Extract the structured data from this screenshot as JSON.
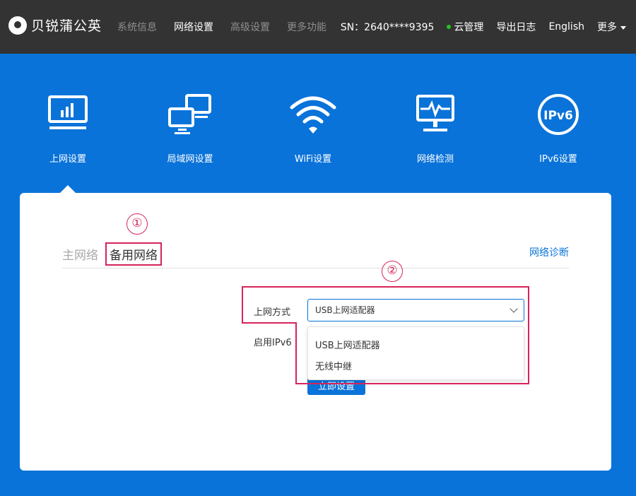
{
  "brand": {
    "name": "贝锐蒲公英"
  },
  "nav": [
    {
      "label": "系统信息",
      "active": false
    },
    {
      "label": "网络设置",
      "active": true
    },
    {
      "label": "高级设置",
      "active": false
    },
    {
      "label": "更多功能",
      "active": false
    }
  ],
  "header_right": {
    "sn": "SN：2640****9395",
    "cloud": "云管理",
    "cloud_status_color": "#22c522",
    "export_log": "导出日志",
    "language": "English",
    "more": "更多"
  },
  "modules": [
    {
      "label": "上网设置",
      "icon": "monitor-chart-icon"
    },
    {
      "label": "局域网设置",
      "icon": "lan-computers-icon"
    },
    {
      "label": "WiFi设置",
      "icon": "wifi-icon"
    },
    {
      "label": "网络检测",
      "icon": "monitor-pulse-icon"
    },
    {
      "label": "IPv6设置",
      "icon": "ipv6-icon",
      "icon_text": "IPv6"
    }
  ],
  "tabs": {
    "main": "主网络",
    "backup": "备用网络",
    "diagnose": "网络诊断"
  },
  "annotations": {
    "marker1": "①",
    "marker2": "②"
  },
  "form": {
    "access_mode_label": "上网方式",
    "access_mode_value": "USB上网适配器",
    "ipv6_label": "启用IPv6",
    "options": [
      "USB上网适配器",
      "无线中继"
    ],
    "submit_label": "立即设置"
  },
  "colors": {
    "accent": "#0a73d9",
    "topbar": "#333333",
    "annotation": "#d6245a"
  }
}
